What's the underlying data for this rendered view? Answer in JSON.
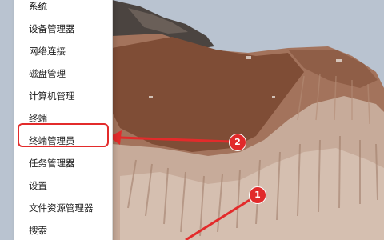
{
  "context_menu": {
    "items": [
      {
        "label": "系统"
      },
      {
        "label": "设备管理器"
      },
      {
        "label": "网络连接"
      },
      {
        "label": "磁盘管理"
      },
      {
        "label": "计算机管理"
      },
      {
        "label": "终端"
      },
      {
        "label": "终端管理员",
        "highlighted": true
      },
      {
        "label": "任务管理器"
      },
      {
        "label": "设置"
      },
      {
        "label": "文件资源管理器"
      },
      {
        "label": "搜索"
      }
    ]
  },
  "annotations": {
    "step_1": "1",
    "step_2": "2",
    "accent_color": "#e32b2b"
  }
}
